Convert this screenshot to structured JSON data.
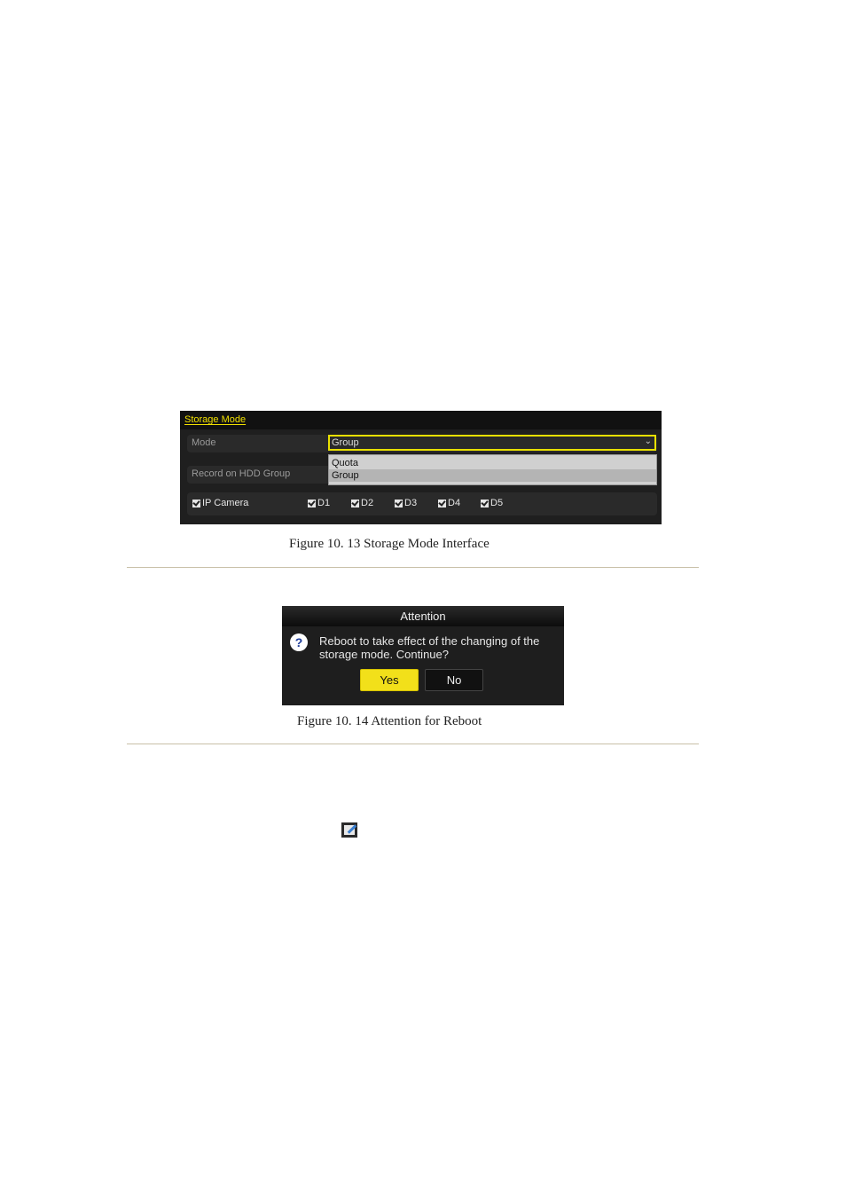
{
  "figure1": {
    "title": "Storage Mode",
    "mode_label": "Mode",
    "mode_value": "Group",
    "dropdown_arrow": "chevron-down-icon",
    "dropdown_options": [
      "Quota",
      "Group"
    ],
    "selected_option": "Group",
    "record_label": "Record on HDD Group",
    "checkboxes": [
      {
        "label": "IP Camera",
        "checked": true
      },
      {
        "label": "D1",
        "checked": true
      },
      {
        "label": "D2",
        "checked": true
      },
      {
        "label": "D3",
        "checked": true
      },
      {
        "label": "D4",
        "checked": true
      },
      {
        "label": "D5",
        "checked": true
      }
    ],
    "caption": "Figure 10. 13  Storage Mode Interface"
  },
  "figure2": {
    "title": "Attention",
    "icon": "question-icon",
    "message": "Reboot to take effect of the changing of the storage mode. Continue?",
    "yes_label": "Yes",
    "no_label": "No",
    "caption": "Figure 10. 14  Attention for Reboot"
  },
  "inline_icon": "edit-icon",
  "colors": {
    "accent_yellow": "#f2e01a",
    "panel_bg": "#1f1f1f"
  }
}
